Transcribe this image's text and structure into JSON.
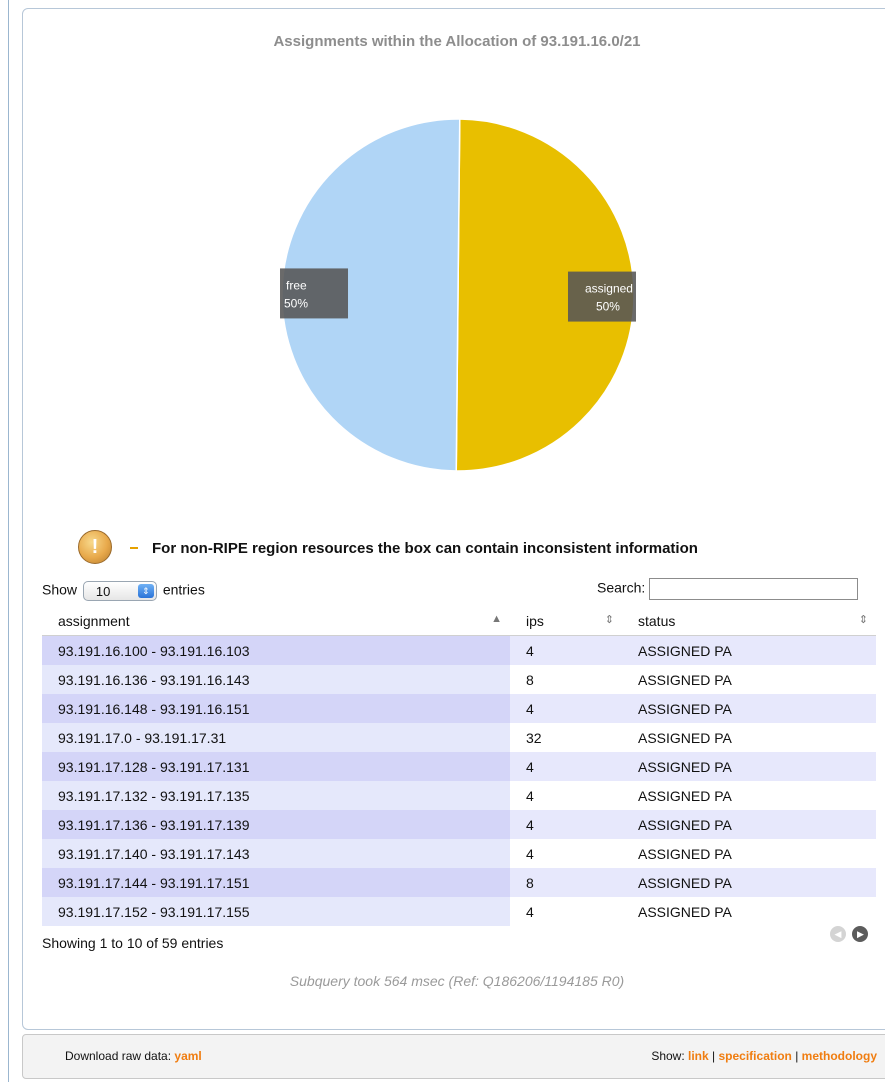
{
  "chart_data": {
    "type": "pie",
    "title": "Assignments within the Allocation of 93.191.16.0/21",
    "slices": [
      {
        "label": "assigned",
        "value": 50,
        "percent_label": "50%",
        "color": "#e8bf00"
      },
      {
        "label": "free",
        "value": 50,
        "percent_label": "50%",
        "color": "#b0d5f6"
      }
    ]
  },
  "notice": {
    "icon": "warning-icon",
    "icon_glyph": "!",
    "text": "For non-RIPE region resources the box can contain inconsistent information"
  },
  "table_controls": {
    "show_label": "Show",
    "length_value": "10",
    "entries_label": "entries",
    "search_label": "Search:"
  },
  "table": {
    "columns": [
      "assignment",
      "ips",
      "status"
    ],
    "rows": [
      [
        "93.191.16.100 - 93.191.16.103",
        "4",
        "ASSIGNED PA"
      ],
      [
        "93.191.16.136 - 93.191.16.143",
        "8",
        "ASSIGNED PA"
      ],
      [
        "93.191.16.148 - 93.191.16.151",
        "4",
        "ASSIGNED PA"
      ],
      [
        "93.191.17.0 - 93.191.17.31",
        "32",
        "ASSIGNED PA"
      ],
      [
        "93.191.17.128 - 93.191.17.131",
        "4",
        "ASSIGNED PA"
      ],
      [
        "93.191.17.132 - 93.191.17.135",
        "4",
        "ASSIGNED PA"
      ],
      [
        "93.191.17.136 - 93.191.17.139",
        "4",
        "ASSIGNED PA"
      ],
      [
        "93.191.17.140 - 93.191.17.143",
        "4",
        "ASSIGNED PA"
      ],
      [
        "93.191.17.144 - 93.191.17.151",
        "8",
        "ASSIGNED PA"
      ],
      [
        "93.191.17.152 - 93.191.17.155",
        "4",
        "ASSIGNED PA"
      ]
    ],
    "info": "Showing 1 to 10 of 59 entries"
  },
  "subquery": "Subquery took 564 msec (Ref: Q186206/1194185 R0)",
  "footer": {
    "download_label": "Download raw data:",
    "download_link": "yaml",
    "show_label": "Show:",
    "links": [
      "link",
      "specification",
      "methodology"
    ],
    "separator": "|"
  }
}
